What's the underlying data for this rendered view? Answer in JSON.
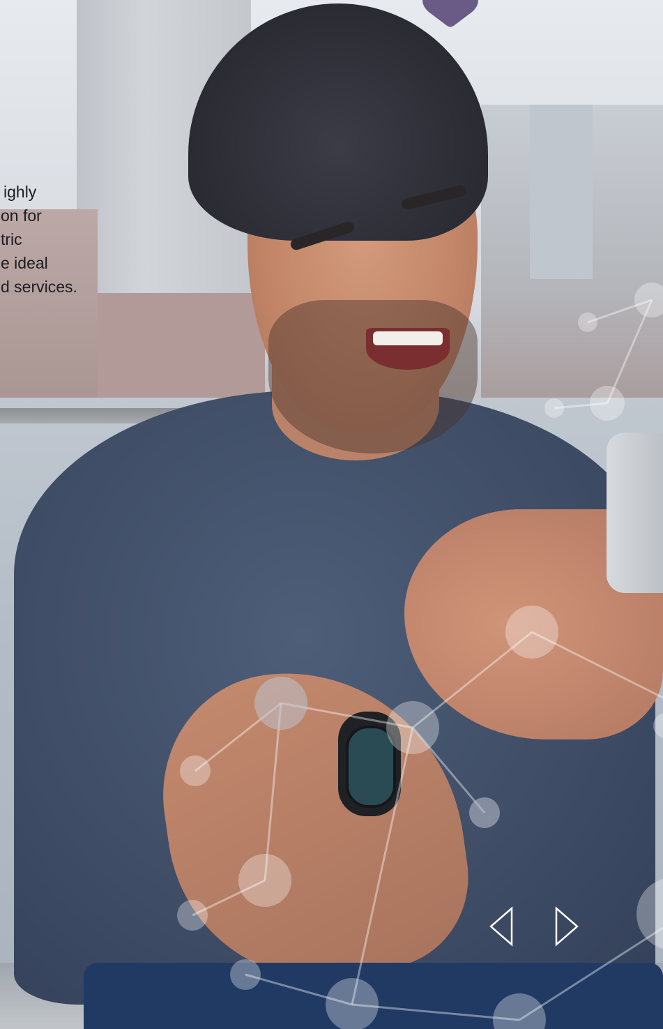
{
  "hero": {
    "image_subject": "smiling man using a smartphone by a city waterfront",
    "tagline_lines": [
      "ighly",
      "on for",
      "tric",
      "e ideal",
      "d services."
    ]
  },
  "carousel": {
    "prev_icon": "triangle-left-outline-icon",
    "next_icon": "triangle-right-outline-icon"
  },
  "colors": {
    "badge": "#6a5a86",
    "arrow": "#ffffff",
    "text": "#1c1d22"
  }
}
